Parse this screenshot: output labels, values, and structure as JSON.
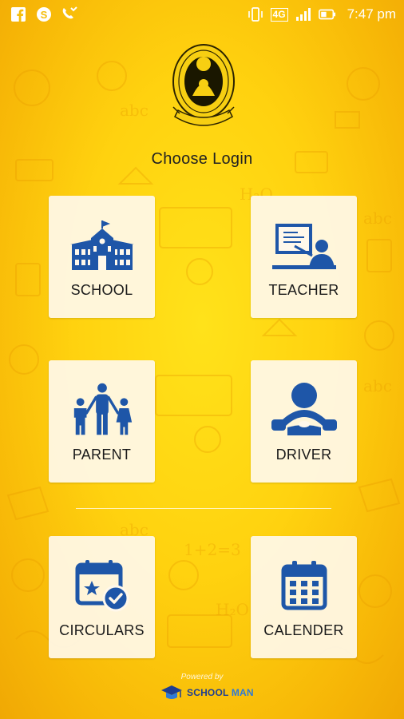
{
  "status_bar": {
    "network": "4G",
    "time": "7:47 pm",
    "left_icons": [
      "facebook-icon",
      "skype-icon",
      "missed-call-icon"
    ],
    "right_icons": [
      "vibrate-icon",
      "signal-icon",
      "battery-icon"
    ]
  },
  "header": {
    "title": "Choose Login"
  },
  "login_options": [
    {
      "label": "SCHOOL",
      "icon": "school-building-icon"
    },
    {
      "label": "TEACHER",
      "icon": "teacher-board-icon"
    },
    {
      "label": "PARENT",
      "icon": "family-icon"
    },
    {
      "label": "DRIVER",
      "icon": "steering-wheel-driver-icon"
    },
    {
      "label": "CIRCULARS",
      "icon": "calendar-check-icon"
    },
    {
      "label": "CALENDER",
      "icon": "calendar-grid-icon"
    }
  ],
  "footer": {
    "powered_by": "Powered by",
    "brand_part1": "SCHOOL",
    "brand_part2": " MAN"
  },
  "colors": {
    "background": "#ffd20f",
    "icon_blue": "#1e56a8",
    "card_bg": "#fff8eb"
  }
}
